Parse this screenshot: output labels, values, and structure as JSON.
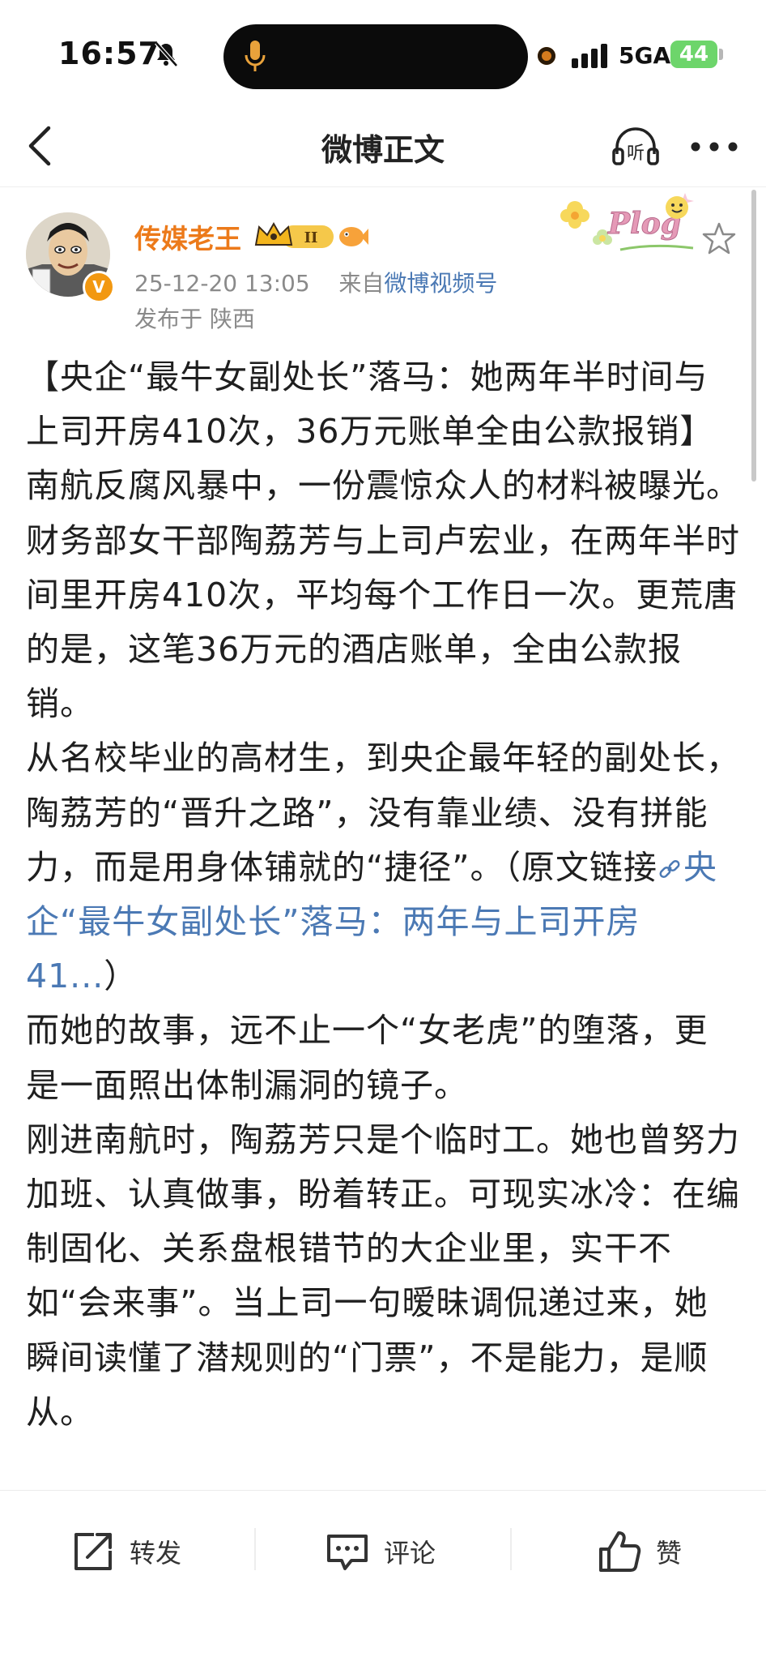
{
  "status_bar": {
    "time": "16:57",
    "network": "5GA",
    "battery": "44"
  },
  "nav": {
    "title": "微博正文",
    "listen_label": "听"
  },
  "post": {
    "author": "传媒老王",
    "vip_level": "II",
    "verified_label": "V",
    "timestamp": "25-12-20 13:05",
    "source_prefix": "来自",
    "source": "微博视频号",
    "location": "发布于 陕西",
    "sticker_text": "Plog",
    "paragraphs": [
      "【央企“最牛女副处长”落马：她两年半时间与上司开房410次，36万元账单全由公款报销】南航反腐风暴中，一份震惊众人的材料被曝光。财务部女干部陶荔芳与上司卢宏业，在两年半时间里开房410次，平均每个工作日一次。更荒唐的是，这笔36万元的酒店账单，全由公款报销。",
      "从名校毕业的高材生，到央企最年轻的副处长，陶荔芳的“晋升之路”，没有靠业绩、没有拼能力，而是用身体铺就的“捷径”。",
      "而她的故事，远不止一个“女老虎”的堕落，更是一面照出体制漏洞的镜子。",
      "刚进南航时，陶荔芳只是个临时工。她也曾努力加班、认真做事，盼着转正。可现实冰冷：在编制固化、关系盘根错节的大企业里，实干不如“会来事”。当上司一句暧昧调侃递过来，她瞬间读懂了潜规则的“门票”，不是能力，是顺从。"
    ],
    "link_prefix": "（原文链接",
    "link_text": "央企“最牛女副处长”落马：两年与上司开房41...",
    "link_suffix": "）"
  },
  "actions": {
    "repost": "转发",
    "comment": "评论",
    "like": "赞"
  },
  "colors": {
    "accent_orange": "#ec7a1a",
    "link_blue": "#4b79b4",
    "battery_green": "#6dd56b"
  }
}
